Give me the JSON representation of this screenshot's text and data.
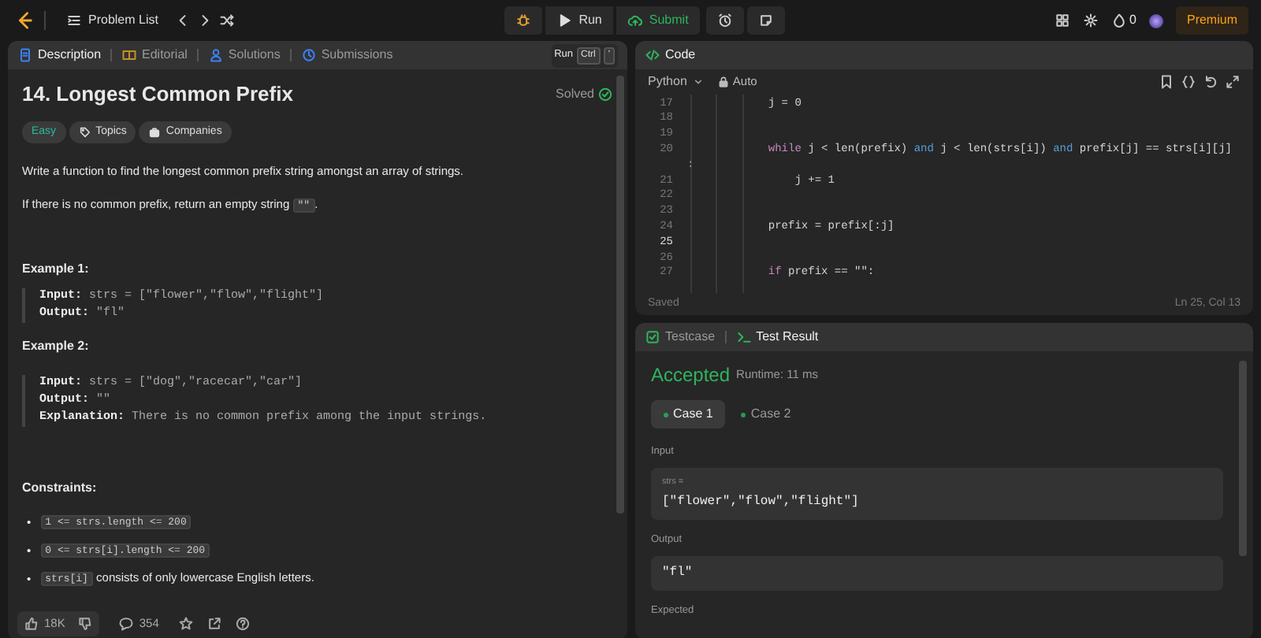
{
  "topbar": {
    "problem_list": "Problem List",
    "run": "Run",
    "submit": "Submit",
    "streak": "0",
    "premium": "Premium"
  },
  "description": {
    "tabs": [
      {
        "label": "Description",
        "selected": true,
        "kind": "doc"
      },
      {
        "label": "Editorial",
        "selected": false,
        "kind": "book"
      },
      {
        "label": "Solutions",
        "selected": false,
        "kind": "flask"
      },
      {
        "label": "Submissions",
        "selected": false,
        "kind": "history"
      }
    ],
    "shortcut": [
      "Run",
      "Ctrl",
      "'"
    ],
    "title": "14. Longest Common Prefix",
    "status": "Solved",
    "tags": [
      {
        "label": "Easy",
        "kind": "difficulty"
      },
      {
        "label": "Topics",
        "kind": "topics"
      },
      {
        "label": "Companies",
        "kind": "companies"
      }
    ],
    "paragraphs": [
      [
        {
          "text": "Write a function to find the longest common prefix string amongst an array of strings.",
          "kind": "text"
        }
      ],
      [
        {
          "text": "If there is no common prefix, return an empty string ",
          "kind": "text"
        },
        {
          "text": "\"\"",
          "kind": "code"
        },
        {
          "text": ".",
          "kind": "text"
        }
      ]
    ],
    "examples": [
      {
        "heading": "Example 1:",
        "lines": [
          {
            "label": "Input:",
            "value": "strs = [\"flower\",\"flow\",\"flight\"]"
          },
          {
            "label": "Output:",
            "value": "\"fl\""
          }
        ]
      },
      {
        "heading": "Example 2:",
        "lines": [
          {
            "label": "Input:",
            "value": "strs = [\"dog\",\"racecar\",\"car\"]"
          },
          {
            "label": "Output:",
            "value": "\"\""
          },
          {
            "label": "Explanation:",
            "value": "There is no common prefix among the input strings."
          }
        ]
      }
    ],
    "constraints_heading": "Constraints:",
    "constraints": [
      {
        "bullet": "•",
        "parts": [
          {
            "text": "1 <= strs.length <= 200",
            "kind": "code"
          }
        ]
      },
      {
        "bullet": "•",
        "parts": [
          {
            "text": "0 <= strs[i].length <= 200",
            "kind": "code"
          }
        ]
      },
      {
        "bullet": "•",
        "parts": [
          {
            "text": "strs[i]",
            "kind": "code"
          },
          {
            "text": " consists of only lowercase English letters.",
            "kind": "text"
          }
        ]
      }
    ],
    "likes": "18K",
    "comments": "354"
  },
  "code": {
    "tab": "Code",
    "language": "Python",
    "mode": "Auto",
    "lines": [
      {
        "number": "17",
        "current": false,
        "tokens": [
          {
            "text": "            j = 0",
            "kind": "plain"
          }
        ]
      },
      {
        "number": "18",
        "current": false
      },
      {
        "number": "19",
        "current": false
      },
      {
        "number": "20",
        "current": false,
        "wrap": ":",
        "tokens": [
          {
            "text": "            while",
            "kind": "keyword"
          },
          {
            "text": " j < len(prefix) ",
            "kind": "plain"
          },
          {
            "text": "and",
            "kind": "operator"
          },
          {
            "text": " j < len(strs[i]) ",
            "kind": "plain"
          },
          {
            "text": "and",
            "kind": "operator"
          },
          {
            "text": " prefix[j] == strs[i][j]",
            "kind": "plain"
          }
        ]
      },
      {
        "number": "21",
        "current": false,
        "tokens": [
          {
            "text": "                j += 1",
            "kind": "plain"
          }
        ]
      },
      {
        "number": "22",
        "current": false
      },
      {
        "number": "23",
        "current": false
      },
      {
        "number": "24",
        "current": false,
        "tokens": [
          {
            "text": "            prefix = prefix[:j]",
            "kind": "plain"
          }
        ]
      },
      {
        "number": "25",
        "current": true
      },
      {
        "number": "26",
        "current": false
      },
      {
        "number": "27",
        "current": false,
        "tokens": [
          {
            "text": "            if",
            "kind": "keyword"
          },
          {
            "text": " prefix == \"\":",
            "kind": "plain"
          }
        ]
      }
    ],
    "status": "Saved",
    "cursor": "Ln 25, Col 13"
  },
  "tests": {
    "tabs": [
      {
        "label": "Testcase",
        "selected": false,
        "kind": "check"
      },
      {
        "label": "Test Result",
        "selected": true,
        "kind": "terminal"
      }
    ],
    "verdict": "Accepted",
    "runtime": "Runtime: 11 ms",
    "cases": [
      {
        "label": "Case 1",
        "selected": true
      },
      {
        "label": "Case 2",
        "selected": false
      }
    ],
    "sections": [
      {
        "label": "Input",
        "variable": "strs =",
        "value": "[\"flower\",\"flow\",\"flight\"]"
      },
      {
        "label": "Output",
        "value": "\"fl\""
      },
      {
        "label": "Expected"
      }
    ]
  }
}
